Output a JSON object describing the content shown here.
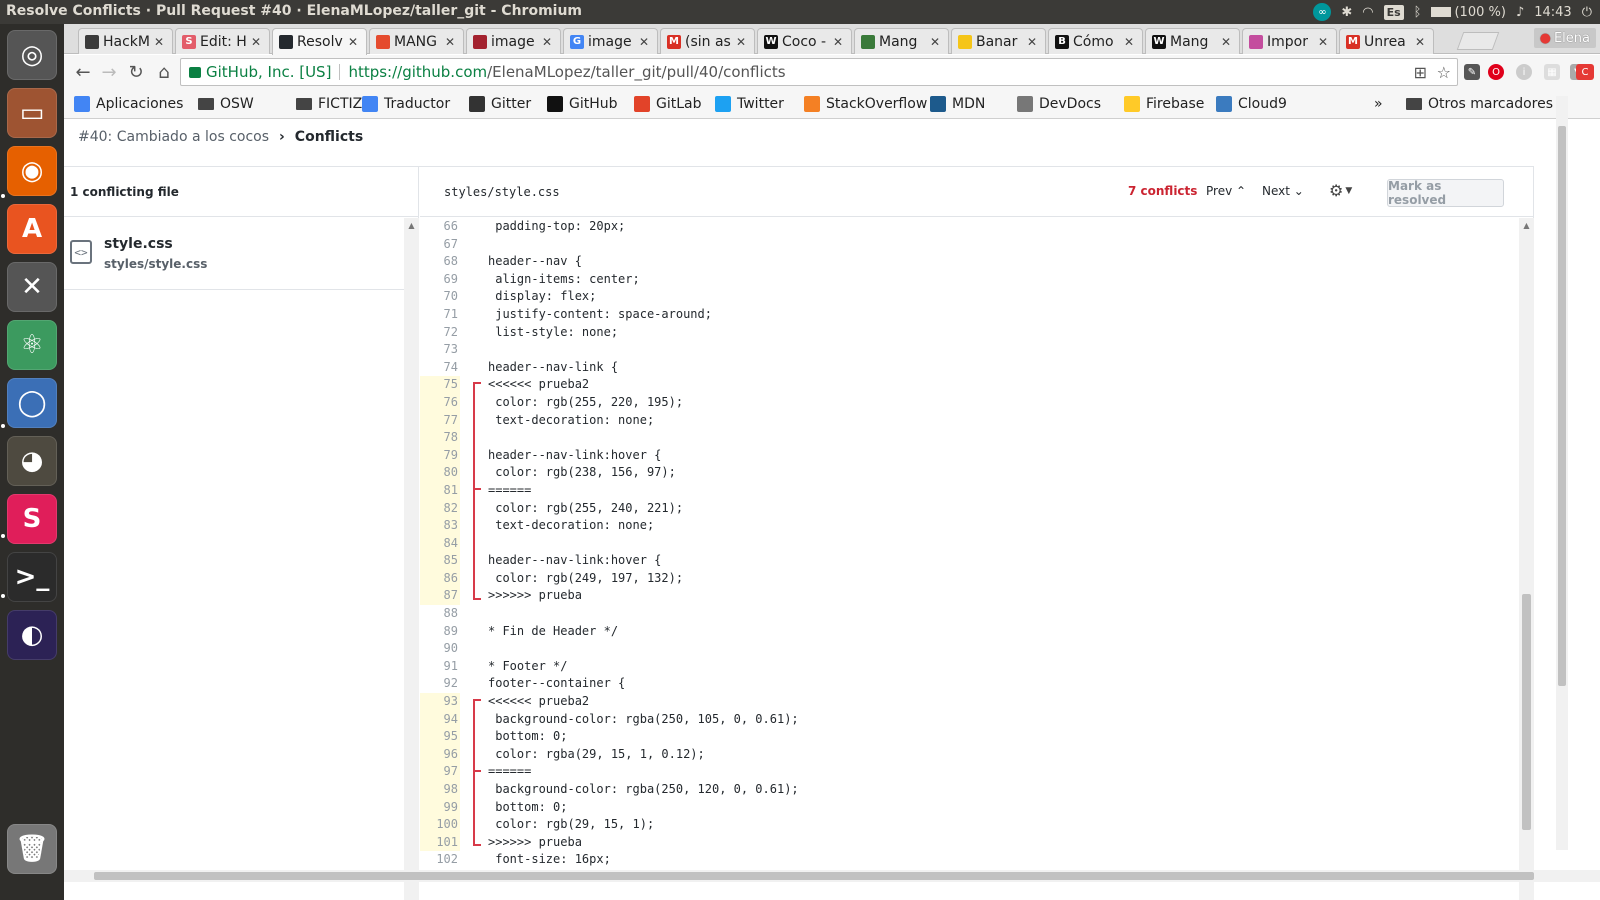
{
  "os_panel": {
    "window_title": "Resolve Conflicts · Pull Request #40 · ElenaMLopez/taller_git - Chromium",
    "keyboard_layout": "Es",
    "battery": "(100 %)",
    "clock": "14:43"
  },
  "launcher": {
    "items": [
      {
        "name": "ubuntu-dash",
        "color": "#555555"
      },
      {
        "name": "files",
        "color": "#9e5432"
      },
      {
        "name": "firefox",
        "color": "#e66000"
      },
      {
        "name": "software-center",
        "color": "#e95420"
      },
      {
        "name": "system-settings",
        "color": "#555555"
      },
      {
        "name": "atom",
        "color": "#3c9a5f"
      },
      {
        "name": "chromium",
        "color": "#3b6fb6"
      },
      {
        "name": "gimp",
        "color": "#4e4a40"
      },
      {
        "name": "slack",
        "color": "#e01e5a"
      },
      {
        "name": "terminal",
        "color": "#2b2b2b"
      },
      {
        "name": "eclipse",
        "color": "#2c2255"
      },
      {
        "name": "trash",
        "color": "#777777"
      }
    ]
  },
  "tabs": [
    {
      "title": "HackM",
      "fav": "",
      "fav_color": "#3b3b3b"
    },
    {
      "title": "Edit: H",
      "fav": "S",
      "fav_color": "#e35d6a"
    },
    {
      "title": "Resolv",
      "fav": "",
      "fav_color": "#24292e",
      "active": true
    },
    {
      "title": "MANG",
      "fav": "",
      "fav_color": "#e54b2e"
    },
    {
      "title": "image",
      "fav": "",
      "fav_color": "#a3212e"
    },
    {
      "title": "image",
      "fav": "G",
      "fav_color": "#4285f4"
    },
    {
      "title": "(sin as",
      "fav": "M",
      "fav_color": "#d93025"
    },
    {
      "title": "Coco -",
      "fav": "W",
      "fav_color": "#111111"
    },
    {
      "title": "Mang",
      "fav": "",
      "fav_color": "#3a7a3a"
    },
    {
      "title": "Banar",
      "fav": "",
      "fav_color": "#f5c518"
    },
    {
      "title": "Cómo",
      "fav": "B",
      "fav_color": "#111111"
    },
    {
      "title": "Mang",
      "fav": "W",
      "fav_color": "#111111"
    },
    {
      "title": "Impor",
      "fav": "",
      "fav_color": "#c44d9e"
    },
    {
      "title": "Unrea",
      "fav": "M",
      "fav_color": "#d93025"
    }
  ],
  "profile_name": "Elena",
  "address_bar": {
    "secure_label": "GitHub, Inc. [US]",
    "url_host": "https://github.com",
    "url_path": "/ElenaMLopez/taller_git/pull/40/conflicts"
  },
  "bookmarks": [
    {
      "label": "Aplicaciones",
      "icon": "apps-icon",
      "color": "#4285f4"
    },
    {
      "label": "OSW",
      "icon": "folder-icon",
      "color": "#444444"
    },
    {
      "label": "FICTIZIA",
      "icon": "folder-icon",
      "color": "#444444"
    },
    {
      "label": "Traductor",
      "icon": "translate-icon",
      "color": "#4285f4"
    },
    {
      "label": "Gitter",
      "icon": "gitter-icon",
      "color": "#333333"
    },
    {
      "label": "GitHub",
      "icon": "github-icon",
      "color": "#111111"
    },
    {
      "label": "GitLab",
      "icon": "gitlab-icon",
      "color": "#e24329"
    },
    {
      "label": "Twitter",
      "icon": "twitter-icon",
      "color": "#1da1f2"
    },
    {
      "label": "StackOverflow",
      "icon": "stackoverflow-icon",
      "color": "#f48024"
    },
    {
      "label": "MDN",
      "icon": "mdn-icon",
      "color": "#1d5a8c"
    },
    {
      "label": "DevDocs",
      "icon": "devdocs-icon",
      "color": "#777777"
    },
    {
      "label": "Firebase",
      "icon": "firebase-icon",
      "color": "#ffca28"
    },
    {
      "label": "Cloud9",
      "icon": "cloud9-icon",
      "color": "#3b7bbf"
    }
  ],
  "bookmarks_overflow": "»",
  "other_bookmarks": "Otros marcadores",
  "breadcrumb": {
    "parent": "#40: Cambiado a los cocos",
    "separator": "›",
    "current": "Conflicts"
  },
  "sidebar": {
    "header": "1 conflicting file",
    "file_name": "style.css",
    "file_path": "styles/style.css",
    "code_icon_glyph": "<>"
  },
  "editor": {
    "filename": "styles/style.css",
    "conflict_count": "7 conflicts",
    "prev_label": "Prev",
    "next_label": "Next",
    "mark_resolved_label": "Mark as resolved"
  },
  "code_lines": [
    {
      "n": "66",
      "text": " padding-top: 20px;"
    },
    {
      "n": "67",
      "text": ""
    },
    {
      "n": "68",
      "text": "header--nav {"
    },
    {
      "n": "69",
      "text": " align-items: center;"
    },
    {
      "n": "70",
      "text": " display: flex;"
    },
    {
      "n": "71",
      "text": " justify-content: space-around;"
    },
    {
      "n": "72",
      "text": " list-style: none;"
    },
    {
      "n": "73",
      "text": ""
    },
    {
      "n": "74",
      "text": "header--nav-link {"
    },
    {
      "n": "75",
      "text": "<<<<<< prueba2",
      "conflict": true
    },
    {
      "n": "76",
      "text": " color: rgb(255, 220, 195);",
      "conflict": true
    },
    {
      "n": "77",
      "text": " text-decoration: none;",
      "conflict": true
    },
    {
      "n": "78",
      "text": "",
      "conflict": true
    },
    {
      "n": "79",
      "text": "header--nav-link:hover {",
      "conflict": true
    },
    {
      "n": "80",
      "text": " color: rgb(238, 156, 97);",
      "conflict": true
    },
    {
      "n": "81",
      "text": "======",
      "conflict": true
    },
    {
      "n": "82",
      "text": " color: rgb(255, 240, 221);",
      "conflict": true
    },
    {
      "n": "83",
      "text": " text-decoration: none;",
      "conflict": true
    },
    {
      "n": "84",
      "text": "",
      "conflict": true
    },
    {
      "n": "85",
      "text": "header--nav-link:hover {",
      "conflict": true
    },
    {
      "n": "86",
      "text": " color: rgb(249, 197, 132);",
      "conflict": true
    },
    {
      "n": "87",
      "text": ">>>>>> prueba",
      "conflict": true
    },
    {
      "n": "88",
      "text": ""
    },
    {
      "n": "89",
      "text": "* Fin de Header */"
    },
    {
      "n": "90",
      "text": ""
    },
    {
      "n": "91",
      "text": "* Footer */"
    },
    {
      "n": "92",
      "text": "footer--container {"
    },
    {
      "n": "93",
      "text": "<<<<<< prueba2",
      "conflict": true
    },
    {
      "n": "94",
      "text": " background-color: rgba(250, 105, 0, 0.61);",
      "conflict": true
    },
    {
      "n": "95",
      "text": " bottom: 0;",
      "conflict": true
    },
    {
      "n": "96",
      "text": " color: rgba(29, 15, 1, 0.12);",
      "conflict": true
    },
    {
      "n": "97",
      "text": "======",
      "conflict": true
    },
    {
      "n": "98",
      "text": " background-color: rgba(250, 120, 0, 0.61);",
      "conflict": true
    },
    {
      "n": "99",
      "text": " bottom: 0;",
      "conflict": true
    },
    {
      "n": "100",
      "text": " color: rgb(29, 15, 1);",
      "conflict": true
    },
    {
      "n": "101",
      "text": ">>>>>> prueba",
      "conflict": true
    },
    {
      "n": "102",
      "text": " font-size: 16px;"
    }
  ],
  "conflict_blocks": [
    {
      "start": 9,
      "mid": 15,
      "end": 21
    },
    {
      "start": 27,
      "mid": 31,
      "end": 35
    }
  ],
  "colors": {
    "conflict_red": "#cb2431",
    "bracket_red": "#d73a49",
    "conflict_gutter": "#fffbdd",
    "secure_green": "#0b8043"
  }
}
